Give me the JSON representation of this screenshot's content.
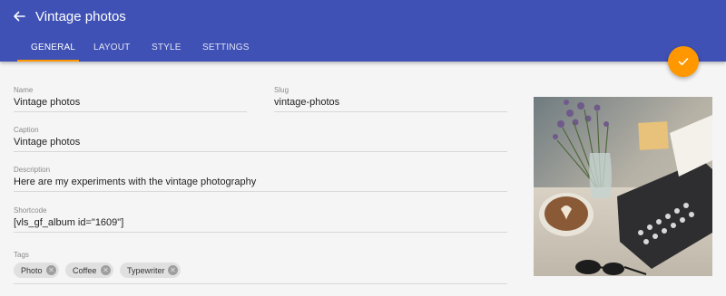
{
  "header": {
    "title": "Vintage photos",
    "tabs": [
      {
        "label": "GENERAL"
      },
      {
        "label": "LAYOUT"
      },
      {
        "label": "STYLE"
      },
      {
        "label": "SETTINGS"
      }
    ]
  },
  "form": {
    "name": {
      "label": "Name",
      "value": "Vintage photos"
    },
    "slug": {
      "label": "Slug",
      "value": "vintage-photos"
    },
    "caption": {
      "label": "Caption",
      "value": "Vintage photos"
    },
    "description": {
      "label": "Description",
      "value": "Here are my experiments with the vintage photography"
    },
    "shortcode": {
      "label": "Shortcode",
      "value": "[vls_gf_album id=\"1609\"]"
    },
    "tags": {
      "label": "Tags",
      "items": [
        "Photo",
        "Coffee",
        "Typewriter"
      ]
    }
  },
  "colors": {
    "primary": "#3f51b5",
    "accent": "#ff9800"
  },
  "icons": {
    "back": "arrow-left-icon",
    "save": "check-icon",
    "remove": "close-circle-icon"
  }
}
